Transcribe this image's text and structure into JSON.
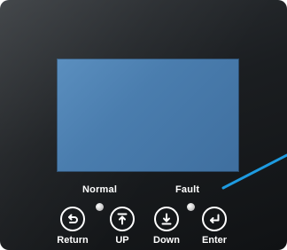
{
  "panel": {
    "status": {
      "normal_label": "Normal",
      "fault_label": "Fault"
    },
    "buttons": [
      {
        "label": "Return",
        "icon": "return-arrow-icon"
      },
      {
        "label": "UP",
        "icon": "up-arrow-icon"
      },
      {
        "label": "Down",
        "icon": "down-arrow-icon"
      },
      {
        "label": "Enter",
        "icon": "enter-arrow-icon"
      }
    ]
  },
  "colors": {
    "panel": "#1b1e21",
    "screen": "#4a7dae",
    "callout_line": "#1e9be0",
    "led": "#d6d6d6",
    "text": "#ffffff"
  }
}
